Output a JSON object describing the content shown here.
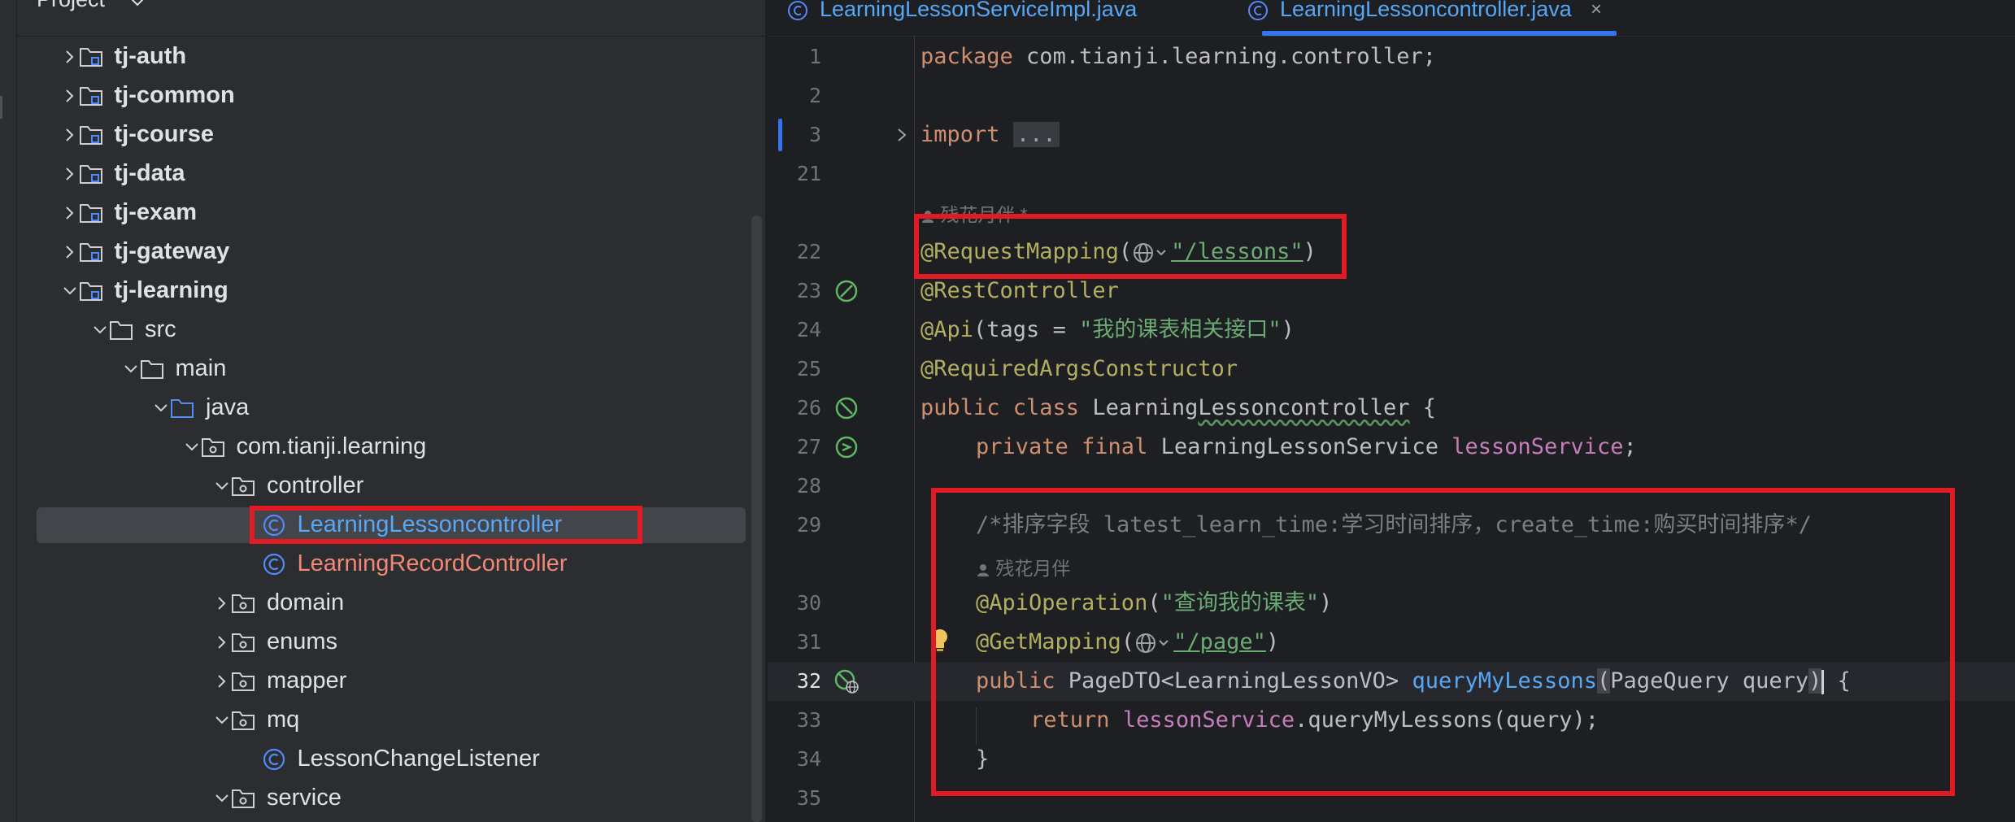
{
  "project_panel": {
    "title": "Project",
    "tree": [
      {
        "label": "tj-auth",
        "expanded": false,
        "icon": "module-folder-icon",
        "bold": true
      },
      {
        "label": "tj-common",
        "expanded": false,
        "icon": "module-folder-icon",
        "bold": true
      },
      {
        "label": "tj-course",
        "expanded": false,
        "icon": "module-folder-icon",
        "bold": true
      },
      {
        "label": "tj-data",
        "expanded": false,
        "icon": "module-folder-icon",
        "bold": true
      },
      {
        "label": "tj-exam",
        "expanded": false,
        "icon": "module-folder-icon",
        "bold": true
      },
      {
        "label": "tj-gateway",
        "expanded": false,
        "icon": "module-folder-icon",
        "bold": true
      },
      {
        "label": "tj-learning",
        "expanded": true,
        "icon": "module-folder-icon",
        "bold": true
      },
      {
        "label": "src",
        "expanded": true,
        "icon": "folder-icon"
      },
      {
        "label": "main",
        "expanded": true,
        "icon": "folder-icon"
      },
      {
        "label": "java",
        "expanded": true,
        "icon": "source-folder-icon"
      },
      {
        "label": "com.tianji.learning",
        "expanded": true,
        "icon": "package-icon"
      },
      {
        "label": "controller",
        "expanded": true,
        "icon": "package-icon"
      },
      {
        "label": "LearningLessoncontroller",
        "icon": "class-icon",
        "selected": true,
        "color": "blue"
      },
      {
        "label": "LearningRecordController",
        "icon": "class-icon",
        "color": "red"
      },
      {
        "label": "domain",
        "expanded": false,
        "icon": "package-icon"
      },
      {
        "label": "enums",
        "expanded": false,
        "icon": "package-icon"
      },
      {
        "label": "mapper",
        "expanded": false,
        "icon": "package-icon"
      },
      {
        "label": "mq",
        "expanded": true,
        "icon": "package-icon"
      },
      {
        "label": "LessonChangeListener",
        "icon": "class-icon"
      },
      {
        "label": "service",
        "expanded": true,
        "icon": "package-icon"
      }
    ]
  },
  "editor": {
    "tabs": [
      {
        "label": "LearningLessonServiceImpl.java",
        "active": false
      },
      {
        "label": "LearningLessoncontroller.java",
        "active": true,
        "close": "×"
      }
    ],
    "line_numbers": {
      "l1": "1",
      "l2": "2",
      "l3": "3",
      "l21": "21",
      "l22": "22",
      "l23": "23",
      "l24": "24",
      "l25": "25",
      "l26": "26",
      "l27": "27",
      "l28": "28",
      "l29": "29",
      "l30": "30",
      "l31": "31",
      "l32": "32",
      "l33": "33",
      "l34": "34",
      "l35": "35"
    },
    "code": {
      "l1_kw": "package",
      "l1_rest": " com.tianji.learning.controller;",
      "l3_kw": "import",
      "l3_fold": "...",
      "author_hint_1": "残花月伴 *",
      "l22_ann": "@RequestMapping",
      "l22_open": "(",
      "l22_str": "\"/lessons\"",
      "l22_close": ")",
      "l23_ann": "@RestController",
      "l24_ann": "@Api",
      "l24_mid": "(tags = ",
      "l24_str": "\"我的课表相关接口\"",
      "l24_close": ")",
      "l25_ann": "@RequiredArgsConstructor",
      "l26_kw": "public class",
      "l26_sp": " ",
      "l26_name_a": "Learning",
      "l26_name_b": "Lessoncontroller",
      "l26_rest": " {",
      "l27_kw": "private final",
      "l27_type": " LearningLessonService ",
      "l27_field": "lessonService",
      "l27_semi": ";",
      "l29_comment": "/*排序字段 latest_learn_time:学习时间排序，create_time:购买时间排序*/",
      "author_hint_2": "残花月伴",
      "l30_ann": "@ApiOperation",
      "l30_open": "(",
      "l30_str": "\"查询我的课表\"",
      "l30_close": ")",
      "l31_ann": "@GetMapping",
      "l31_open": "(",
      "l31_str": "\"/page\"",
      "l31_close": ")",
      "l32_kw": "public",
      "l32_type": " PageDTO<LearningLessonVO> ",
      "l32_method": "queryMyLessons",
      "l32_paren_open": "(",
      "l32_params": "PageQuery query",
      "l32_paren_close": ")",
      "l32_brace": " {",
      "l33_kw": "return",
      "l33_sp": " ",
      "l33_field": "lessonService",
      "l33_rest": ".queryMyLessons(query);",
      "l34_brace": "}"
    }
  },
  "colors": {
    "highlight_box": "#e01b24",
    "accent": "#3574f0"
  }
}
